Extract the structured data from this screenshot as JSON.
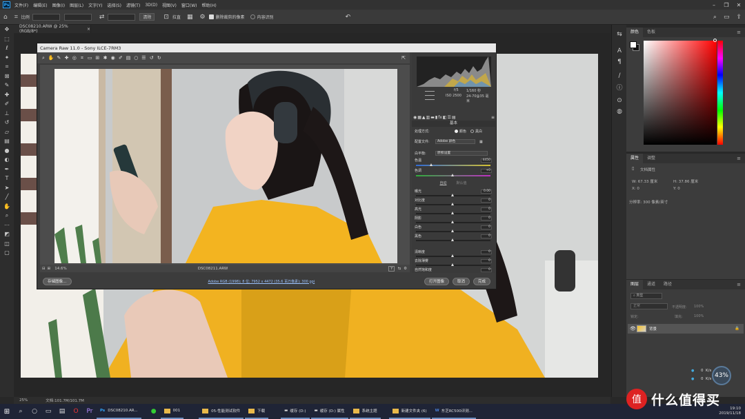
{
  "menubar": {
    "logo": "Ps",
    "items": [
      "文件(F)",
      "编辑(E)",
      "图像(I)",
      "图层(L)",
      "文字(Y)",
      "选择(S)",
      "滤镜(T)",
      "3D(D)",
      "视图(V)",
      "窗口(W)",
      "帮助(H)"
    ]
  },
  "options": {
    "ratio": "比例",
    "clear": "清除",
    "straighten": "拉直",
    "delete_cropped": "删除裁剪的像素",
    "content_aware": "内容识别"
  },
  "doc_tab": {
    "title": "DSC08210.ARW @ 25%(RGB/8*)",
    "close": "×"
  },
  "camera_raw": {
    "title": "Camera Raw 11.0 -  Sony ILCE-7RM3",
    "cam_info": {
      "aperture": "f/5",
      "shutter": "1/160 秒",
      "iso": "ISO 2500",
      "lens": "24-70@35 毫米"
    },
    "panel_title": "基本",
    "treatment_label": "处理方式:",
    "color_option": "颜色",
    "bw_option": "黑白",
    "profile_label": "配置文件:",
    "profile_value": "Adobe 颜色",
    "wb_label": "白平衡:",
    "wb_value": "原照设置",
    "temp_label": "色温",
    "temp_value": "4450",
    "tint_label": "色调",
    "tint_value": "+0",
    "auto": "自动",
    "default": "默认值",
    "rows": [
      {
        "label": "曝光",
        "value": "0.00"
      },
      {
        "label": "对比度",
        "value": "0"
      },
      {
        "label": "高光",
        "value": "0"
      },
      {
        "label": "阴影",
        "value": "0"
      },
      {
        "label": "白色",
        "value": "0"
      },
      {
        "label": "黑色",
        "value": "0"
      },
      {
        "label": "清晰度",
        "value": "0"
      },
      {
        "label": "去除薄雾",
        "value": "0"
      },
      {
        "label": "自然饱和度",
        "value": "0"
      },
      {
        "label": "饱和度",
        "value": "0"
      }
    ],
    "zoom": "14.6%",
    "filename": "DSC08211.ARW",
    "y_btn": "Y",
    "save_btn": "存储图像…",
    "workflow": "Adobe RGB (1998); 8 位; 7952 x 4472 (35.6 百万像素); 300 ppi",
    "open_btn": "打开图像",
    "cancel_btn": "取消",
    "done_btn": "完成"
  },
  "color_panel": {
    "tab_color": "颜色",
    "tab_swatch": "色板"
  },
  "props_panel": {
    "tab_props": "属性",
    "tab_adjust": "调整",
    "doc_props": "文档属性",
    "w": "W:  67.33 厘米",
    "h": "H:  37.86 厘米",
    "x": "X:  0",
    "y": "Y:  0",
    "resolution": "分辨率: 300 像素/英寸"
  },
  "layers_panel": {
    "tab_layers": "图层",
    "tab_channels": "通道",
    "tab_paths": "路径",
    "kind": "类型",
    "blend": "正常",
    "opacity_label": "不透明度:",
    "opacity": "100%",
    "lock_label": "锁定:",
    "fill_label": "填充:",
    "fill": "100%",
    "layer_name": "背景"
  },
  "net": {
    "up": "0",
    "up_unit": "K/s",
    "down": "0",
    "down_unit": "K/s",
    "percent": "43%"
  },
  "status": {
    "zoom": "25%",
    "doc": "文档:101.7M/101.7M"
  },
  "taskbar": {
    "apps": [
      {
        "label": "DSC08210.AR..."
      },
      {
        "label": "001"
      },
      {
        "label": "05-性能测试软件"
      },
      {
        "label": "下载"
      },
      {
        "label": "缓存 (D:)"
      },
      {
        "label": "缓存 (D:) 属性"
      },
      {
        "label": "系统主题"
      },
      {
        "label": "新建文件夹 (6)"
      },
      {
        "label": "东芝RC500评测..."
      }
    ],
    "time": "19:10",
    "date": "2019/11/18",
    "watermark": "什么值得买",
    "wm_logo": "值"
  },
  "colors": {
    "accent": "#31a8ff",
    "hoodie": "#f5b921",
    "panel": "#3c3c3c"
  }
}
